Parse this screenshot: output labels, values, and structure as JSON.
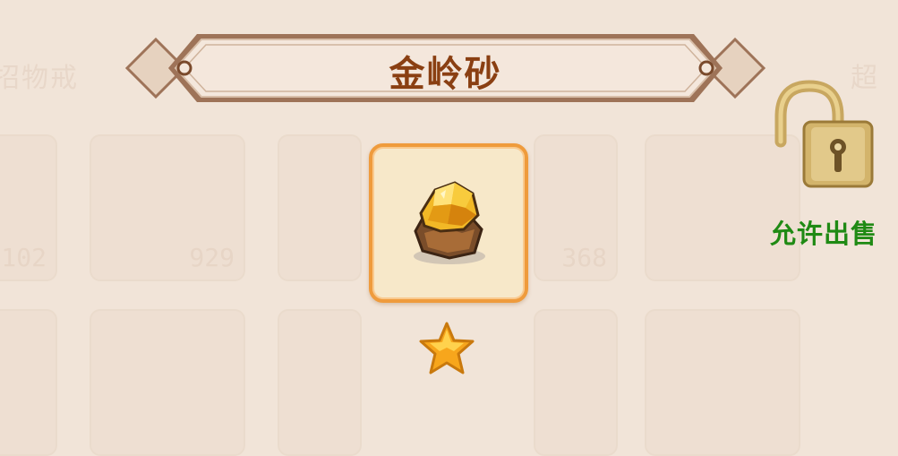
{
  "item": {
    "name": "金岭砂",
    "icon": "gold-ore-icon",
    "stars": 1,
    "frame_color": "#ef9b3c"
  },
  "trade": {
    "sell_status": "允许出售",
    "lock_icon": "unlocked-padlock-icon",
    "status_color": "#1f8a14"
  },
  "background": {
    "left_label": "招物戒",
    "right_label": "超",
    "counts": [
      "102",
      "929",
      "368"
    ]
  },
  "colors": {
    "background": "#f1e4d8",
    "title_text": "#8a3f12"
  }
}
